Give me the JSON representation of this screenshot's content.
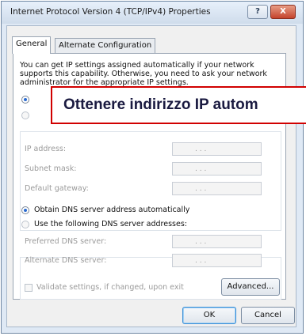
{
  "window": {
    "title": "Internet Protocol Version 4 (TCP/IPv4) Properties",
    "help_label": "?",
    "close_label": "X"
  },
  "tabs": [
    {
      "label": "General",
      "active": true
    },
    {
      "label": "Alternate Configuration",
      "active": false
    }
  ],
  "intro_text": "You can get IP settings assigned automatically if your network supports this capability. Otherwise, you need to ask your network administrator for the appropriate IP settings.",
  "ip_settings": {
    "fields": [
      {
        "label": "IP address:",
        "value": ". . ."
      },
      {
        "label": "Subnet mask:",
        "value": ". . ."
      },
      {
        "label": "Default gateway:",
        "value": ". . ."
      }
    ]
  },
  "dns_settings": {
    "obtain_auto_label": "Obtain DNS server address automatically",
    "obtain_auto_selected": true,
    "use_following_label": "Use the following DNS server addresses:",
    "fields": [
      {
        "label": "Preferred DNS server:",
        "value": ". . ."
      },
      {
        "label": "Alternate DNS server:",
        "value": ". . ."
      }
    ]
  },
  "validate_label": "Validate settings, if changed, upon exit",
  "validate_checked": false,
  "buttons": {
    "advanced": "Advanced...",
    "ok": "OK",
    "cancel": "Cancel"
  },
  "overlay_caption": "Ottenere indirizzo IP autom",
  "colors": {
    "overlay_border": "#d10000",
    "radio_selected": "#2a6bd1",
    "close_button": "#c4432c"
  }
}
